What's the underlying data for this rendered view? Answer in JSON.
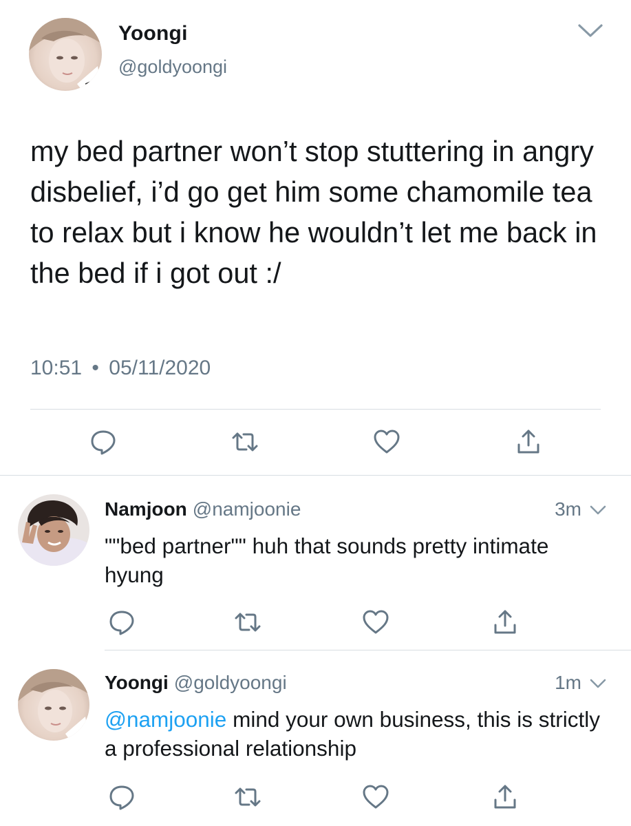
{
  "main_tweet": {
    "display_name": "Yoongi",
    "handle": "@goldyoongi",
    "text": "my bed partner won’t stop stuttering in angry disbelief, i’d go get him some chamomile tea to relax but i know he wouldn’t let me back in the bed if i got out :/",
    "time": "10:51",
    "separator": "•",
    "date": "05/11/2020"
  },
  "replies": [
    {
      "display_name": "Namjoon",
      "handle": "@namjoonie",
      "age": "3m",
      "text": "\"\"bed partner\"\" huh that sounds pretty intimate hyung"
    },
    {
      "display_name": "Yoongi",
      "handle": "@goldyoongi",
      "age": "1m",
      "mention": "@namjoonie",
      "text": " mind your own business, this is strictly a professional relationship"
    }
  ],
  "icons": {
    "reply": "reply-icon",
    "retweet": "retweet-icon",
    "like": "heart-icon",
    "share": "share-icon",
    "menu": "chevron-down-icon"
  },
  "colors": {
    "icon_gray": "#657786",
    "link_blue": "#1da1f2",
    "text": "#14171a",
    "divider": "#d7dde2"
  }
}
